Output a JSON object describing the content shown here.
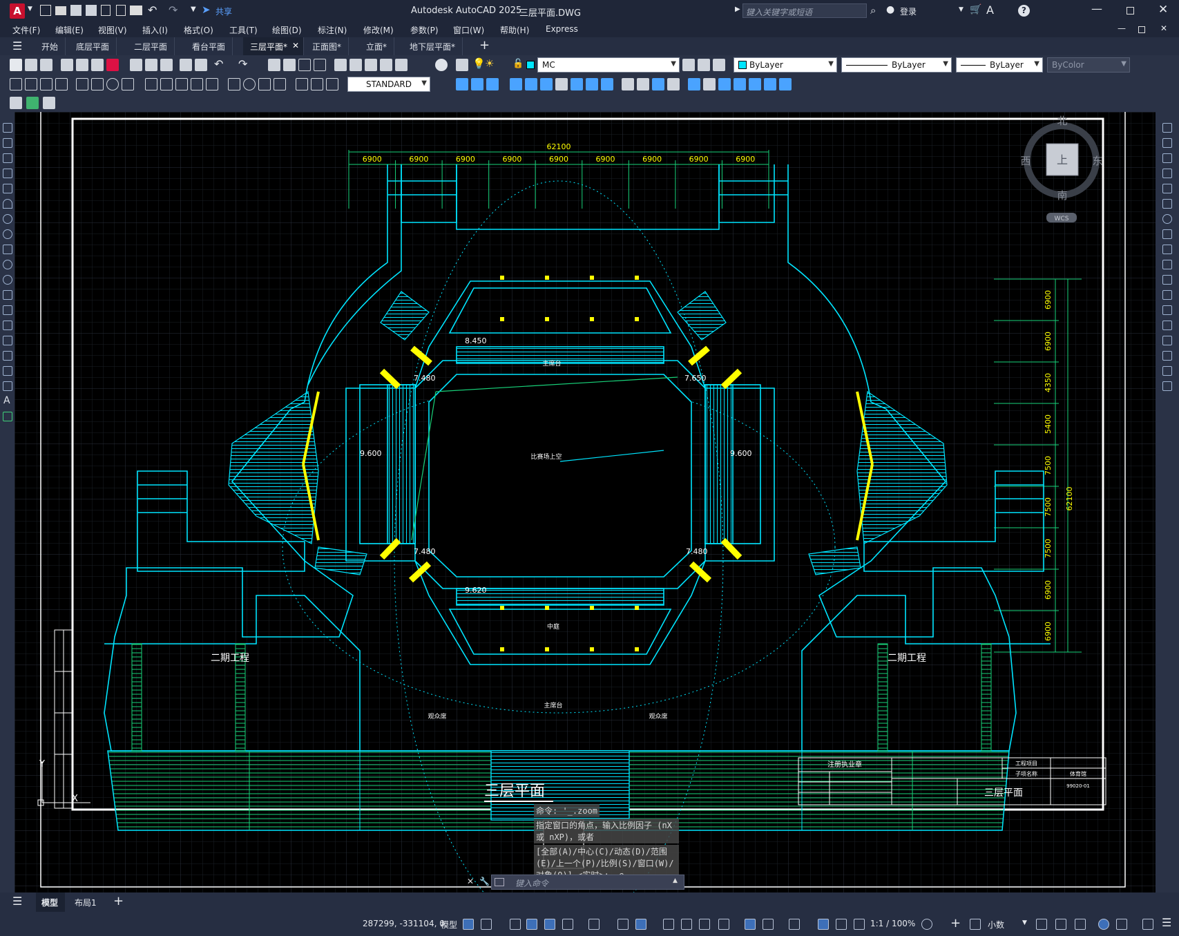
{
  "window": {
    "app_title": "Autodesk AutoCAD 2025",
    "file_title": "三层平面.DWG",
    "share_label": "共享",
    "search_placeholder": "键入关键字或短语",
    "signin_label": "登录"
  },
  "menu": [
    "文件(F)",
    "编辑(E)",
    "视图(V)",
    "插入(I)",
    "格式(O)",
    "工具(T)",
    "绘图(D)",
    "标注(N)",
    "修改(M)",
    "参数(P)",
    "窗口(W)",
    "帮助(H)",
    "Express"
  ],
  "doc_tabs": [
    {
      "label": "开始"
    },
    {
      "label": "底层平面"
    },
    {
      "label": "二层平面"
    },
    {
      "label": "看台平面"
    },
    {
      "label": "三层平面*"
    },
    {
      "label": "正面图*"
    },
    {
      "label": "立面*"
    },
    {
      "label": "地下层平面*"
    }
  ],
  "toolbar": {
    "layer_name": "MC",
    "color": "ByLayer",
    "linetype": "ByLayer",
    "lineweight": "ByLayer",
    "plotstyle": "ByColor",
    "text_style": "STANDARD"
  },
  "viewcube": {
    "north": "北",
    "south": "南",
    "east": "东",
    "west": "西",
    "face": "上",
    "ucs": "WCS"
  },
  "drawing": {
    "top_dims": [
      "62100",
      "6900",
      "6900",
      "6900",
      "6900",
      "6900",
      "6900",
      "6900",
      "6900",
      "6900"
    ],
    "right_dims": [
      "6900",
      "6900",
      "4350",
      "5400",
      "7500",
      "7500",
      "7500",
      "6900",
      "6900"
    ],
    "right_total": "62100",
    "levels": [
      "8.450",
      "7.480",
      "7.650",
      "9.600",
      "9.600",
      "7.480",
      "7.480",
      "9.620"
    ],
    "labels": {
      "main_platform": "主席台",
      "arena_void": "比赛场上空",
      "center": "中庭",
      "phase2_left": "二期工程",
      "phase2_right": "二期工程",
      "lower_platform": "主席台",
      "viewing_left": "观众席",
      "viewing_right": "观众席",
      "sheet_title": "三层平面"
    },
    "title_block": {
      "header": "注册执业章",
      "project": "工程项目",
      "subproject": "子项名称",
      "building": "体育馆",
      "drawing_name": "三层平面",
      "drawing_no": "99020-01"
    }
  },
  "command": {
    "history": [
      "命令: '_.zoom",
      "指定窗口的角点，输入比例因子 (nX 或 nXP)，或者",
      "[全部(A)/中心(C)/动态(D)/范围(E)/上一个(P)/比例(S)/窗口(W)/对象(O)] <实时>: _e"
    ],
    "placeholder": "键入命令"
  },
  "layout_tabs": [
    "模型",
    "布局1"
  ],
  "status": {
    "coords": "287299, -331104, 0",
    "model": "模型",
    "scale": "1:1 / 100%",
    "units": "小数"
  }
}
